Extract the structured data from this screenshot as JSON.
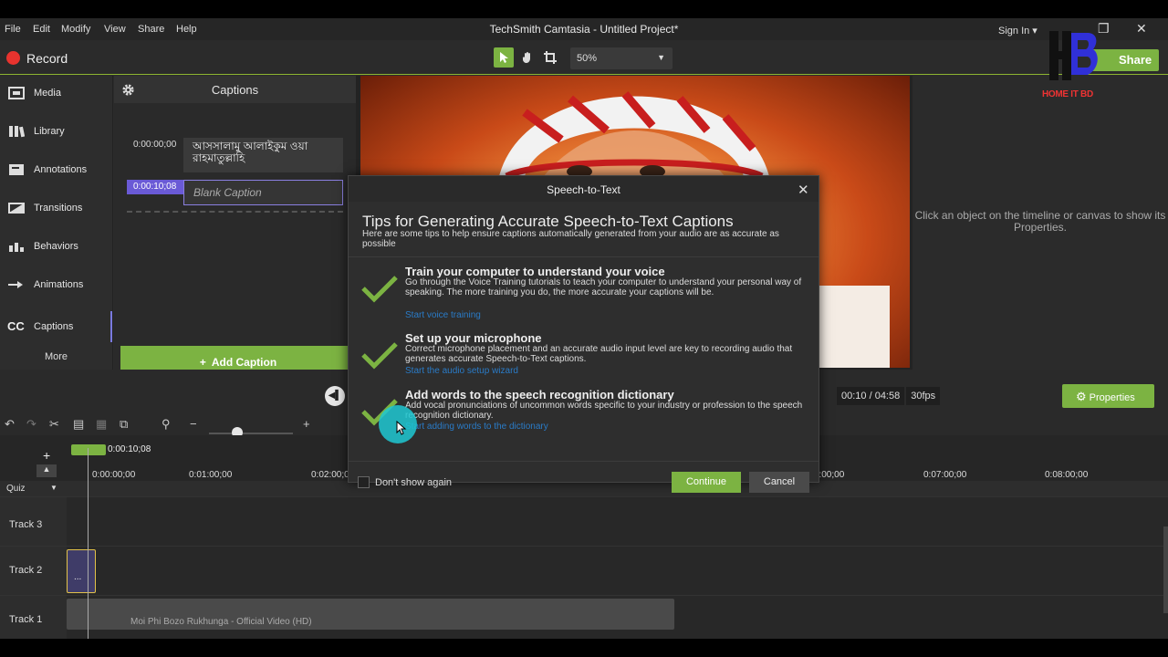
{
  "menu": {
    "items": [
      "File",
      "Edit",
      "Modify",
      "View",
      "Share",
      "Help"
    ],
    "window_title": "TechSmith Camtasia - Untitled Project*",
    "sign_in": "Sign In ▾"
  },
  "toolbar": {
    "record_label": "Record",
    "zoom_value": "50%",
    "share_label": "Share"
  },
  "watermark": {
    "text": "HOME IT BD"
  },
  "sidebar": {
    "items": [
      {
        "label": "Media",
        "icon": "media-icon"
      },
      {
        "label": "Library",
        "icon": "library-icon"
      },
      {
        "label": "Annotations",
        "icon": "annotations-icon"
      },
      {
        "label": "Transitions",
        "icon": "transitions-icon"
      },
      {
        "label": "Behaviors",
        "icon": "behaviors-icon"
      },
      {
        "label": "Animations",
        "icon": "animations-icon"
      },
      {
        "label": "Captions",
        "icon": "cc-icon",
        "active": true
      }
    ],
    "more_label": "More",
    "cc_glyph": "CC"
  },
  "captions": {
    "title": "Captions",
    "rows": [
      {
        "time": "0:00:00;00",
        "text": "আসসালামু আলাইকুম ওয়া রাহমাতুল্লাহি"
      },
      {
        "time": "0:00:10;08",
        "text": "Blank Caption"
      }
    ],
    "add_label": "Add Caption"
  },
  "canvas": {
    "properties_hint": "Click an object on the timeline or canvas to show its Properties."
  },
  "transport": {
    "time_current": "00:10 / 04:58",
    "fps": "30fps",
    "properties_label": "Properties"
  },
  "timeline": {
    "playhead_time": "0:00:10;08",
    "ticks": [
      "0:00:00;00",
      "0:01:00;00",
      "0:02:00;00",
      "0:06:00;00",
      "0:07:00;00",
      "0:08:00;00"
    ],
    "quiz_label": "Quiz",
    "tracks": [
      "Track 3",
      "Track 2",
      "Track 1"
    ],
    "clip2_label": "...",
    "clip1_label": "Moi Phi Bozo Rukhunga - Official Video (HD)"
  },
  "dialog": {
    "title": "Speech-to-Text",
    "heading": "Tips for Generating Accurate Speech-to-Text Captions",
    "intro": "Here are some tips to help ensure captions automatically generated from your audio are as accurate as possible",
    "tips": [
      {
        "title": "Train your computer to understand your voice",
        "body": "Go through the Voice Training tutorials to teach your computer to understand your personal way of speaking. The more training you do, the more accurate your captions will be.",
        "link": "Start voice training"
      },
      {
        "title": "Set up your microphone",
        "body": "Correct microphone placement and an accurate audio input level are key to recording audio that generates accurate Speech-to-Text captions.",
        "link": "Start the audio setup wizard"
      },
      {
        "title": "Add words to the speech recognition dictionary",
        "body": "Add vocal pronunciations of uncommon words specific to your industry or profession to the speech recognition dictionary.",
        "link": "Start adding words to the dictionary"
      }
    ],
    "dont_show": "Don't show again",
    "continue_label": "Continue",
    "cancel_label": "Cancel"
  },
  "colors": {
    "accent_green": "#7cb342",
    "record_red": "#e8332e",
    "caption_purple": "#6a5ad6",
    "link_blue": "#2a7bc7",
    "cursor_cyan": "#1ec8d2"
  }
}
